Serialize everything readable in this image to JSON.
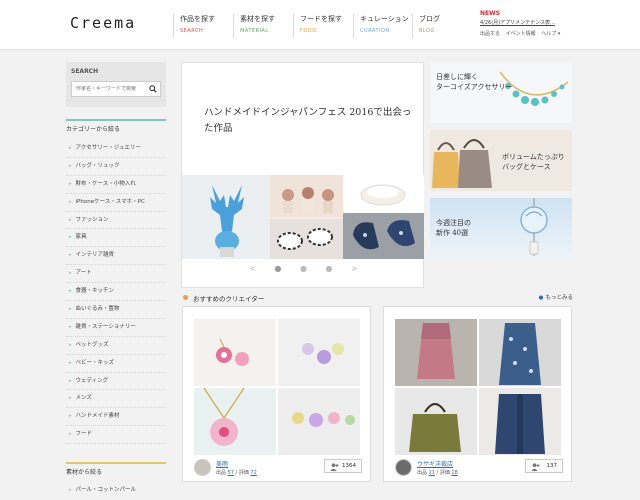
{
  "header": {
    "logo": "Creema",
    "nav": [
      {
        "ja": "作品を探す",
        "en": "SEARCH",
        "color": "#d9534f"
      },
      {
        "ja": "素材を探す",
        "en": "MATERIAL",
        "color": "#6ba86b"
      },
      {
        "ja": "フードを探す",
        "en": "FOOD",
        "color": "#e0a040"
      },
      {
        "ja": "キュレーション",
        "en": "CURATION",
        "color": "#6aa9d6"
      },
      {
        "ja": "ブログ",
        "en": "BLOG",
        "color": "#c49a5a"
      }
    ],
    "news_label": "NEWS",
    "news_text": "4/26(月)アプリメンテナンス表...",
    "util_links": [
      "出品する",
      "イベント情報",
      "ヘルプ ▾"
    ]
  },
  "sidebar": {
    "search_title": "SEARCH",
    "search_placeholder": "作家名・キーワードで検索",
    "category_heading": "カテゴリーから絞る",
    "categories": [
      "アクセサリー・ジュエリー",
      "バッグ・リュック",
      "財布・ケース・小物入れ",
      "iPhoneケース・スマホ・PC",
      "ファッション",
      "家具",
      "インテリア雑貨",
      "アート",
      "食器・キッチン",
      "ぬいぐるみ・置物",
      "雑貨・ステーショナリー",
      "ペットグッズ",
      "ベビー・キッズ",
      "ウェディング",
      "メンズ",
      "ハンドメイド素材",
      "フード"
    ],
    "material_heading": "素材から絞る",
    "material_item": "パール・コットンパール"
  },
  "hero": {
    "title": "ハンドメイドインジャパンフェス 2016で出会った作品",
    "prev": "<",
    "next": ">",
    "dots": [
      "●",
      "●",
      "●"
    ]
  },
  "banners": [
    {
      "text": "日差しに輝く\nターコイズアクセサリー"
    },
    {
      "text": "ボリュームたっぷり\nバッグとケース"
    },
    {
      "text": "今週注目の\n新作 40選"
    }
  ],
  "recommended": {
    "title": "おすすめのクリエイター",
    "more": "もっとみる",
    "creators": [
      {
        "name": "美雨",
        "stats_prefix": "出品 ",
        "works": "57",
        "sep": " / 評価 ",
        "rating": "72",
        "favorites": "1364"
      },
      {
        "name": "ウサギ洋裁店",
        "stats_prefix": "出品 ",
        "works": "21",
        "sep": " / 評価 ",
        "rating": "18",
        "favorites": "137"
      }
    ]
  }
}
